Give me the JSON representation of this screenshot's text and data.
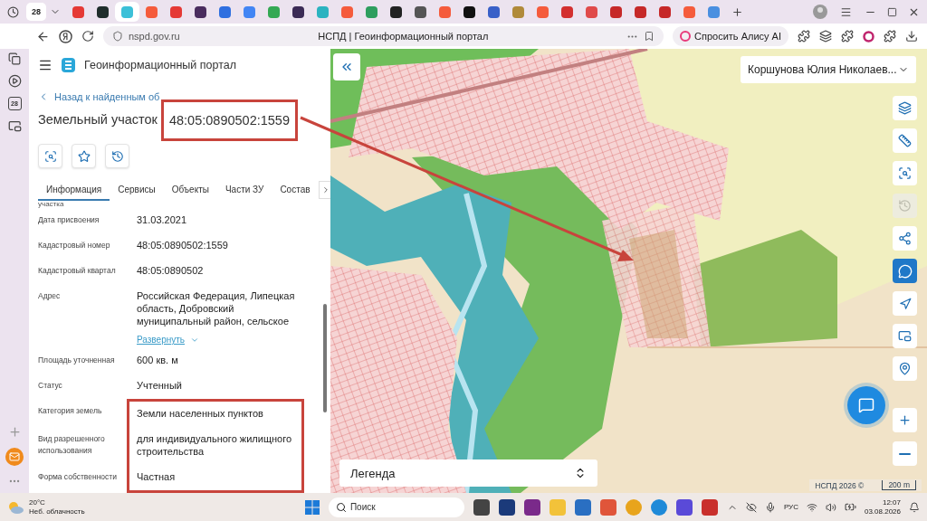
{
  "browser": {
    "pinned_tab": "28",
    "tabs": [
      {
        "color": "#e53935",
        "selected": false
      },
      {
        "color": "#1f2d2b",
        "selected": false
      },
      {
        "color": "#3cc0d8",
        "selected": true
      },
      {
        "color": "#f55b3c",
        "selected": false
      },
      {
        "color": "#e53935",
        "selected": false
      },
      {
        "color": "#4a2c5e",
        "selected": false
      },
      {
        "color": "#2f6fe0",
        "selected": false
      },
      {
        "color": "#4285f4",
        "selected": false
      },
      {
        "color": "#34a853",
        "selected": false
      },
      {
        "color": "#3b2a55",
        "selected": false
      },
      {
        "color": "#2bb3c0",
        "selected": false
      },
      {
        "color": "#f55b3c",
        "selected": false
      },
      {
        "color": "#2e9e5e",
        "selected": false
      },
      {
        "color": "#222222",
        "selected": false
      },
      {
        "color": "#555555",
        "selected": false
      },
      {
        "color": "#f55b3c",
        "selected": false
      },
      {
        "color": "#111111",
        "selected": false
      },
      {
        "color": "#3960c8",
        "selected": false
      },
      {
        "color": "#b08a3a",
        "selected": false
      },
      {
        "color": "#f55b3c",
        "selected": false
      },
      {
        "color": "#d32f2f",
        "selected": false
      },
      {
        "color": "#e04a4a",
        "selected": false
      },
      {
        "color": "#c62828",
        "selected": false
      },
      {
        "color": "#c62828",
        "selected": false
      },
      {
        "color": "#c62828",
        "selected": false
      },
      {
        "color": "#f55b3c",
        "selected": false
      },
      {
        "color": "#4a8fe0",
        "selected": false
      }
    ],
    "url": "nspd.gov.ru",
    "page_title": "НСПД | Геоинформационный портал",
    "alice_button": "Спросить Алису AI"
  },
  "sidebar": {
    "calendar_label": "28"
  },
  "panel": {
    "title": "Геоинформационный портал",
    "back_link": "Назад к найденным об",
    "heading": "Земельный участок",
    "cadastral_number": "48:05:0890502:1559",
    "number_highlighted": true,
    "tabs": [
      {
        "label": "Информация",
        "selected": true
      },
      {
        "label": "Сервисы",
        "selected": false
      },
      {
        "label": "Объекты",
        "selected": false
      },
      {
        "label": "Части ЗУ",
        "selected": false
      },
      {
        "label": "Состав",
        "selected": false
      }
    ],
    "cut_label": "участка",
    "properties": [
      {
        "label": "Дата присвоения",
        "value": "31.03.2021",
        "highlighted": false
      },
      {
        "label": "Кадастровый номер",
        "value": "48:05:0890502:1559",
        "highlighted": false
      },
      {
        "label": "Кадастровый квартал",
        "value": "48:05:0890502",
        "highlighted": false
      },
      {
        "label": "Адрес",
        "value": "Российская Федерация, Липецкая область, Добровский муниципальный район, сельское",
        "expand_link": "Развернуть",
        "highlighted": false
      },
      {
        "label": "Площадь уточненная",
        "value": "600 кв. м",
        "highlighted": false
      },
      {
        "label": "Статус",
        "value": "Учтенный",
        "highlighted": false
      },
      {
        "label": "Категория земель",
        "value": "Земли населенных пунктов",
        "highlighted": true
      },
      {
        "label": "Вид разрешенного использования",
        "value": "для индивидуального жилищного строительства",
        "highlighted": true
      },
      {
        "label": "Форма собственности",
        "value": "Частная",
        "highlighted": true
      }
    ]
  },
  "map": {
    "user": "Коршунова Юлия Николаев...",
    "tools": [
      {
        "kind": "layers",
        "selected": false,
        "disabled": false
      },
      {
        "kind": "ruler",
        "selected": false,
        "disabled": false
      },
      {
        "kind": "select",
        "selected": false,
        "disabled": false
      },
      {
        "kind": "history",
        "selected": false,
        "disabled": true
      },
      {
        "kind": "share",
        "selected": false,
        "disabled": false
      },
      {
        "kind": "chat",
        "selected": true,
        "disabled": false
      },
      {
        "kind": "navigate",
        "selected": false,
        "disabled": false
      },
      {
        "kind": "window",
        "selected": false,
        "disabled": false
      },
      {
        "kind": "locate",
        "selected": false,
        "disabled": false
      }
    ],
    "legend": "Легенда",
    "attribution": "НСПД 2026 ©",
    "scale": "200 m"
  },
  "taskbar": {
    "temperature": "20°C",
    "weather": "Неб. облачность",
    "search_placeholder": "Поиск",
    "language": "РУС",
    "time": "12:07",
    "date": "03.08.2026"
  }
}
